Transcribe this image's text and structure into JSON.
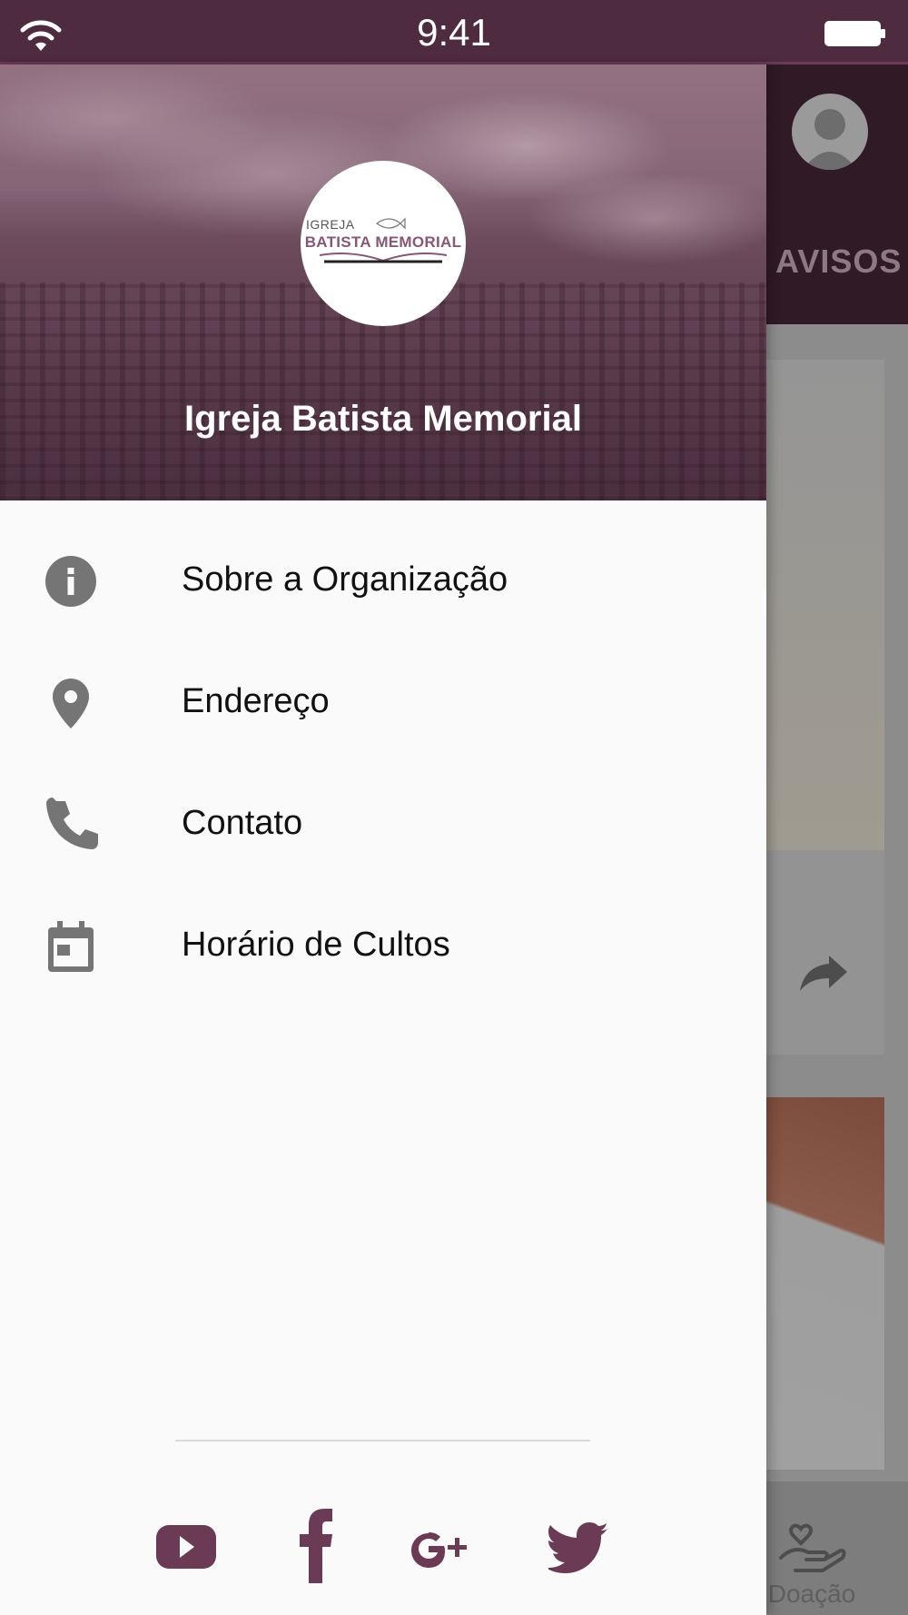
{
  "status_bar": {
    "time": "9:41"
  },
  "drawer": {
    "org_name": "Igreja Batista Memorial",
    "logo": {
      "small_text": "IGREJA",
      "big_text": "BATISTA MEMORIAL"
    },
    "menu": [
      {
        "label": "Sobre a Organização",
        "icon": "info-icon"
      },
      {
        "label": "Endereço",
        "icon": "location-pin-icon"
      },
      {
        "label": "Contato",
        "icon": "phone-icon"
      },
      {
        "label": "Horário de Cultos",
        "icon": "calendar-icon"
      }
    ],
    "social": [
      "youtube-icon",
      "facebook-icon",
      "google-plus-icon",
      "twitter-icon"
    ]
  },
  "background_app": {
    "tab_label": "AVISOS",
    "bottom_nav_label": "Doação"
  },
  "colors": {
    "primary": "#4f2b3f",
    "accent": "#6b3a55",
    "icon_gray": "#757575"
  }
}
